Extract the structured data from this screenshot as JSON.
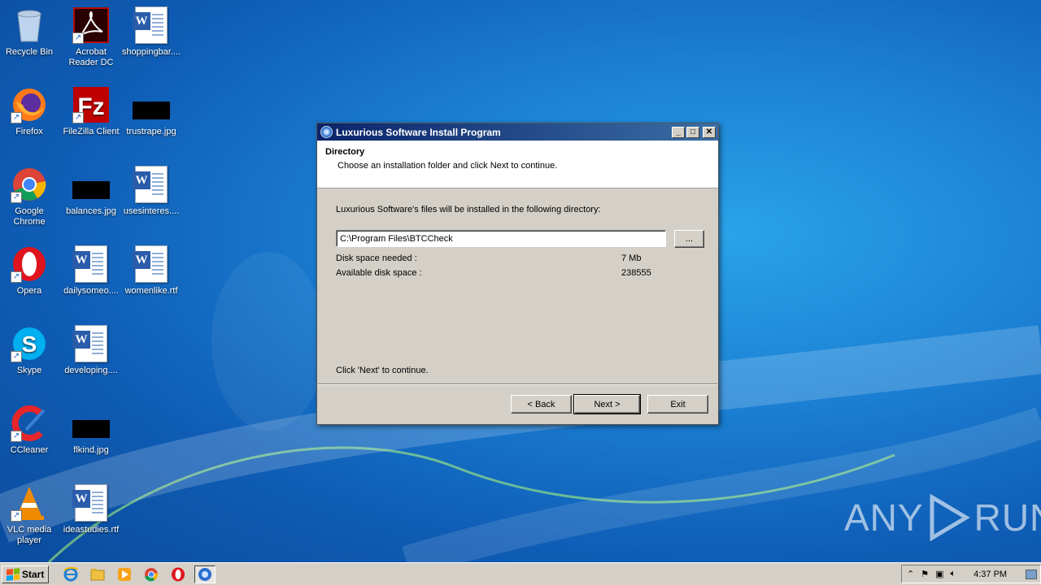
{
  "desktop": {
    "icons": [
      {
        "label": "Recycle Bin",
        "icon": "recycle-bin-icon"
      },
      {
        "label": "Acrobat Reader DC",
        "icon": "acrobat-icon"
      },
      {
        "label": "shoppingbar....",
        "icon": "word-document-icon"
      },
      {
        "label": "Firefox",
        "icon": "firefox-icon"
      },
      {
        "label": "FileZilla Client",
        "icon": "filezilla-icon"
      },
      {
        "label": "trustrape.jpg",
        "icon": "image-thumbnail-icon"
      },
      {
        "label": "Google Chrome",
        "icon": "chrome-icon"
      },
      {
        "label": "balances.jpg",
        "icon": "image-thumbnail-icon"
      },
      {
        "label": "usesinteres....",
        "icon": "word-document-icon"
      },
      {
        "label": "Opera",
        "icon": "opera-icon"
      },
      {
        "label": "dailysomeo....",
        "icon": "word-document-icon"
      },
      {
        "label": "womenlike.rtf",
        "icon": "word-document-icon"
      },
      {
        "label": "Skype",
        "icon": "skype-icon"
      },
      {
        "label": "developing....",
        "icon": "word-document-icon"
      },
      {
        "label": "CCleaner",
        "icon": "ccleaner-icon"
      },
      {
        "label": "flkind.jpg",
        "icon": "image-thumbnail-icon"
      },
      {
        "label": "VLC media player",
        "icon": "vlc-icon"
      },
      {
        "label": "ideastudies.rtf",
        "icon": "word-document-icon"
      }
    ]
  },
  "dialog": {
    "title": "Luxurious Software Install Program",
    "header_title": "Directory",
    "header_subtitle": "Choose an installation folder and click Next to continue.",
    "intro": "Luxurious Software's files will be installed in the following directory:",
    "path_value": "C:\\Program Files\\BTCCheck",
    "browse_label": "...",
    "disk_needed_label": "Disk space needed :",
    "disk_needed_value": "7 Mb",
    "disk_available_label": "Available disk space :",
    "disk_available_value": "238555",
    "footer_hint": "Click 'Next' to continue.",
    "back_label": "< Back",
    "next_label": "Next >",
    "exit_label": "Exit",
    "minimize_glyph": "_",
    "maximize_glyph": "□",
    "close_glyph": "✕"
  },
  "taskbar": {
    "start_label": "Start",
    "quick_launch": [
      "ie-icon",
      "explorer-icon",
      "media-player-icon",
      "chrome-icon",
      "opera-icon",
      "installer-icon"
    ],
    "clock": "4:37 PM"
  },
  "watermark": {
    "text_left": "ANY",
    "text_right": "RUN"
  },
  "colors": {
    "title_bar_start": "#0a246a",
    "title_bar_end": "#3a6ea5",
    "desktop_blue": "#1b7fd3"
  }
}
